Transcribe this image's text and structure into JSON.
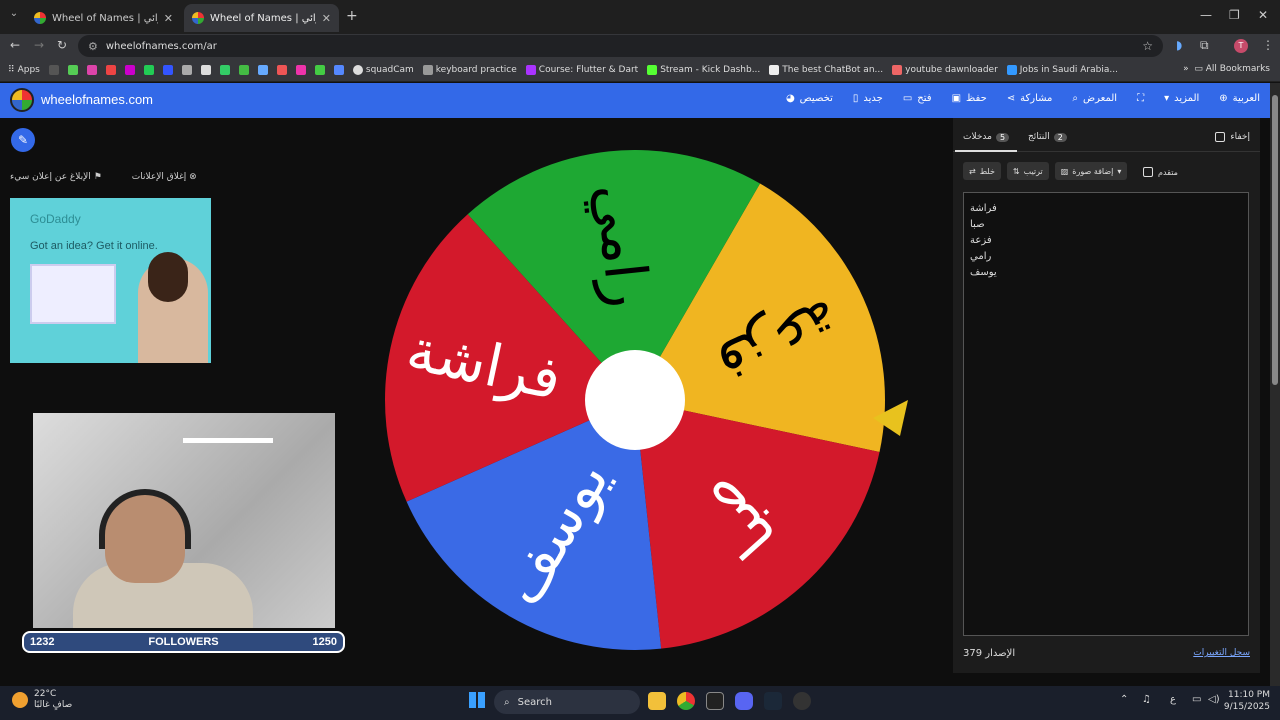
{
  "browser": {
    "tabs": [
      {
        "title": "Wheel of Names | عجلة الاسم العشوائي",
        "active": false
      },
      {
        "title": "Wheel of Names | عجلة الاسم العشوائي",
        "active": true
      }
    ],
    "url": "wheelofnames.com/ar",
    "profile_initial": "T",
    "bookmarks": [
      "Apps",
      "squadCam",
      "keyboard practice",
      "Course: Flutter & Dart",
      "Stream - Kick Dashb...",
      "The best ChatBot an...",
      "youtube dawnloader",
      "Jobs in Saudi Arabia..."
    ],
    "all_bookmarks": "All Bookmarks"
  },
  "site": {
    "name": "wheelofnames.com",
    "menu": [
      "العربية",
      "المزيد",
      "المعرض",
      "مشاركة",
      "حفظ",
      "فتح",
      "جديد",
      "تخصيص"
    ]
  },
  "left": {
    "report_ad": "الإبلاغ عن إعلان سيء",
    "close_ads": "إغلاق الإعلانات",
    "ad": {
      "brand": "GoDaddy",
      "tagline": "Got an idea? Get it online."
    },
    "followers": {
      "current": "1232",
      "label": "FOLLOWERS",
      "goal": "1250"
    }
  },
  "wheel": {
    "segments": [
      {
        "label": "فزعة",
        "color": "#f0b521",
        "text_color": "#000000"
      },
      {
        "label": "صبا",
        "color": "#d3192b",
        "text_color": "#ffffff"
      },
      {
        "label": "يوسف",
        "color": "#3a6ae6",
        "text_color": "#ffffff"
      },
      {
        "label": "فراشة",
        "color": "#d3192b",
        "text_color": "#ffffff"
      },
      {
        "label": "رامي",
        "color": "#1ea833",
        "text_color": "#000000"
      }
    ],
    "pointer_color": "#e8c21e"
  },
  "panel": {
    "tabs": [
      {
        "label": "مدخلات",
        "count": "5",
        "active": true
      },
      {
        "label": "النتائج",
        "count": "2",
        "active": false
      }
    ],
    "hide_label": "إخفاء",
    "buttons": [
      "خلط",
      "ترتيب",
      "إضافة صورة"
    ],
    "advanced_label": "متقدم",
    "entries": [
      "فراشة",
      "صبا",
      "فزعة",
      "رامي",
      "يوسف"
    ],
    "version": "379 الإصدار",
    "changelog": "سجل التغييرات"
  },
  "taskbar": {
    "temp": "22°C",
    "weather": "صافٍ غالبًا",
    "search": "Search",
    "lang": "ع",
    "time": "11:10 PM",
    "date": "9/15/2025"
  }
}
